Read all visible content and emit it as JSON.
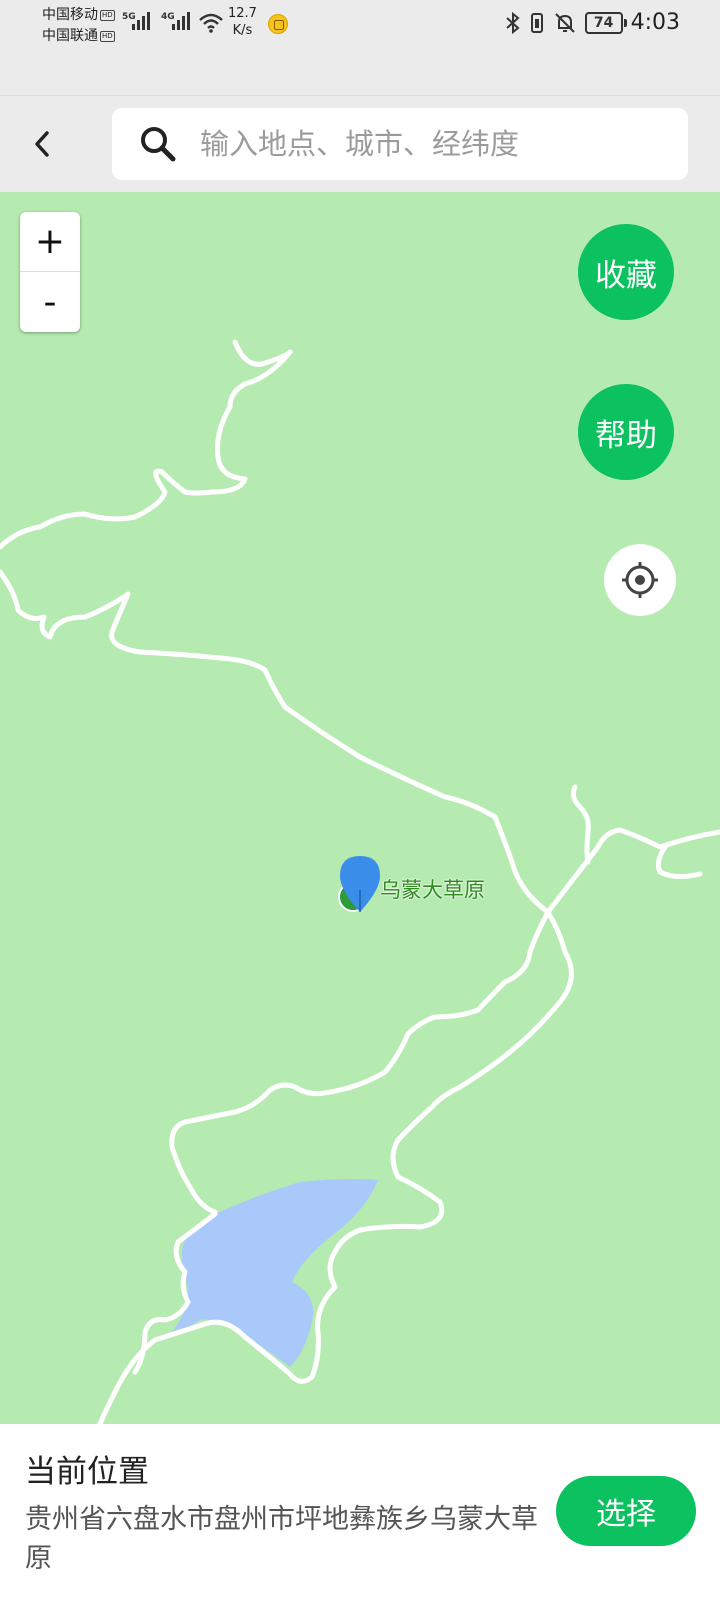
{
  "status_bar": {
    "carrier_1": "中国移动",
    "carrier_2": "中国联通",
    "carrier_badge": "HD",
    "network_1": "5G",
    "network_2": "4G",
    "net_speed_value": "12.7",
    "net_speed_unit": "K/s",
    "battery": "74",
    "time": "4:03",
    "icons": [
      "signal-icon",
      "wifi-icon",
      "coin-app-icon",
      "bluetooth-icon",
      "vibrate-icon",
      "mute-bell-icon",
      "battery-icon"
    ]
  },
  "header": {
    "back_icon": "chevron-left-icon",
    "search_icon": "search-icon",
    "search_placeholder": "输入地点、城市、经纬度",
    "search_value": ""
  },
  "map": {
    "zoom_in_label": "+",
    "zoom_out_label": "-",
    "favorite_label": "收藏",
    "help_label": "帮助",
    "locate_icon": "crosshair-icon",
    "poi_name": "乌蒙大草原",
    "colors": {
      "land": "#b5eab0",
      "road": "#ffffff",
      "water": "#a9c9fb",
      "accent": "#0cc160",
      "pin": "#3a8de8"
    }
  },
  "bottom_panel": {
    "title": "当前位置",
    "address": "贵州省六盘水市盘州市坪地彝族乡乌蒙大草原",
    "select_label": "选择"
  }
}
